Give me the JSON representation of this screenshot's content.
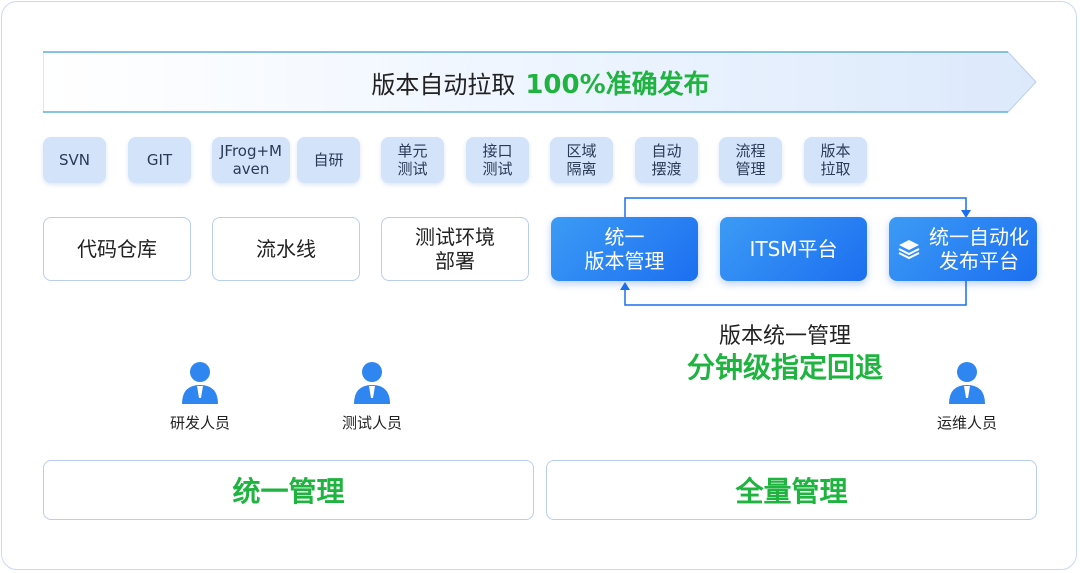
{
  "banner": {
    "text": "版本自动拉取",
    "highlight": "100%准确发布"
  },
  "chips": [
    {
      "label": "SVN"
    },
    {
      "label": "GIT"
    },
    {
      "label": "JFrog+M\naven"
    },
    {
      "label": "自研"
    },
    {
      "label": "单元\n测试"
    },
    {
      "label": "接口\n测试"
    },
    {
      "label": "区域\n隔离"
    },
    {
      "label": "自动\n摆渡"
    },
    {
      "label": "流程\n管理"
    },
    {
      "label": "版本\n拉取"
    }
  ],
  "boxes": [
    {
      "label": "代码仓库"
    },
    {
      "label": "流水线"
    },
    {
      "label": "测试环境\n部署"
    }
  ],
  "blue_boxes": [
    {
      "label": "统一\n版本管理"
    },
    {
      "label": "ITSM平台"
    },
    {
      "label": "统一自动化\n发布平台",
      "icon": "layers-icon"
    }
  ],
  "caption": {
    "line1": "版本统一管理",
    "line2": "分钟级指定回退"
  },
  "people": [
    {
      "label": "研发人员",
      "icon": "user-icon"
    },
    {
      "label": "测试人员",
      "icon": "user-icon"
    },
    {
      "label": "运维人员",
      "icon": "user-icon"
    }
  ],
  "footer": {
    "left": "统一管理",
    "right": "全量管理"
  },
  "colors": {
    "accent_green": "#1fb33f",
    "accent_blue": "#1c6ff0",
    "chip_bg": "#d2e3fa"
  }
}
